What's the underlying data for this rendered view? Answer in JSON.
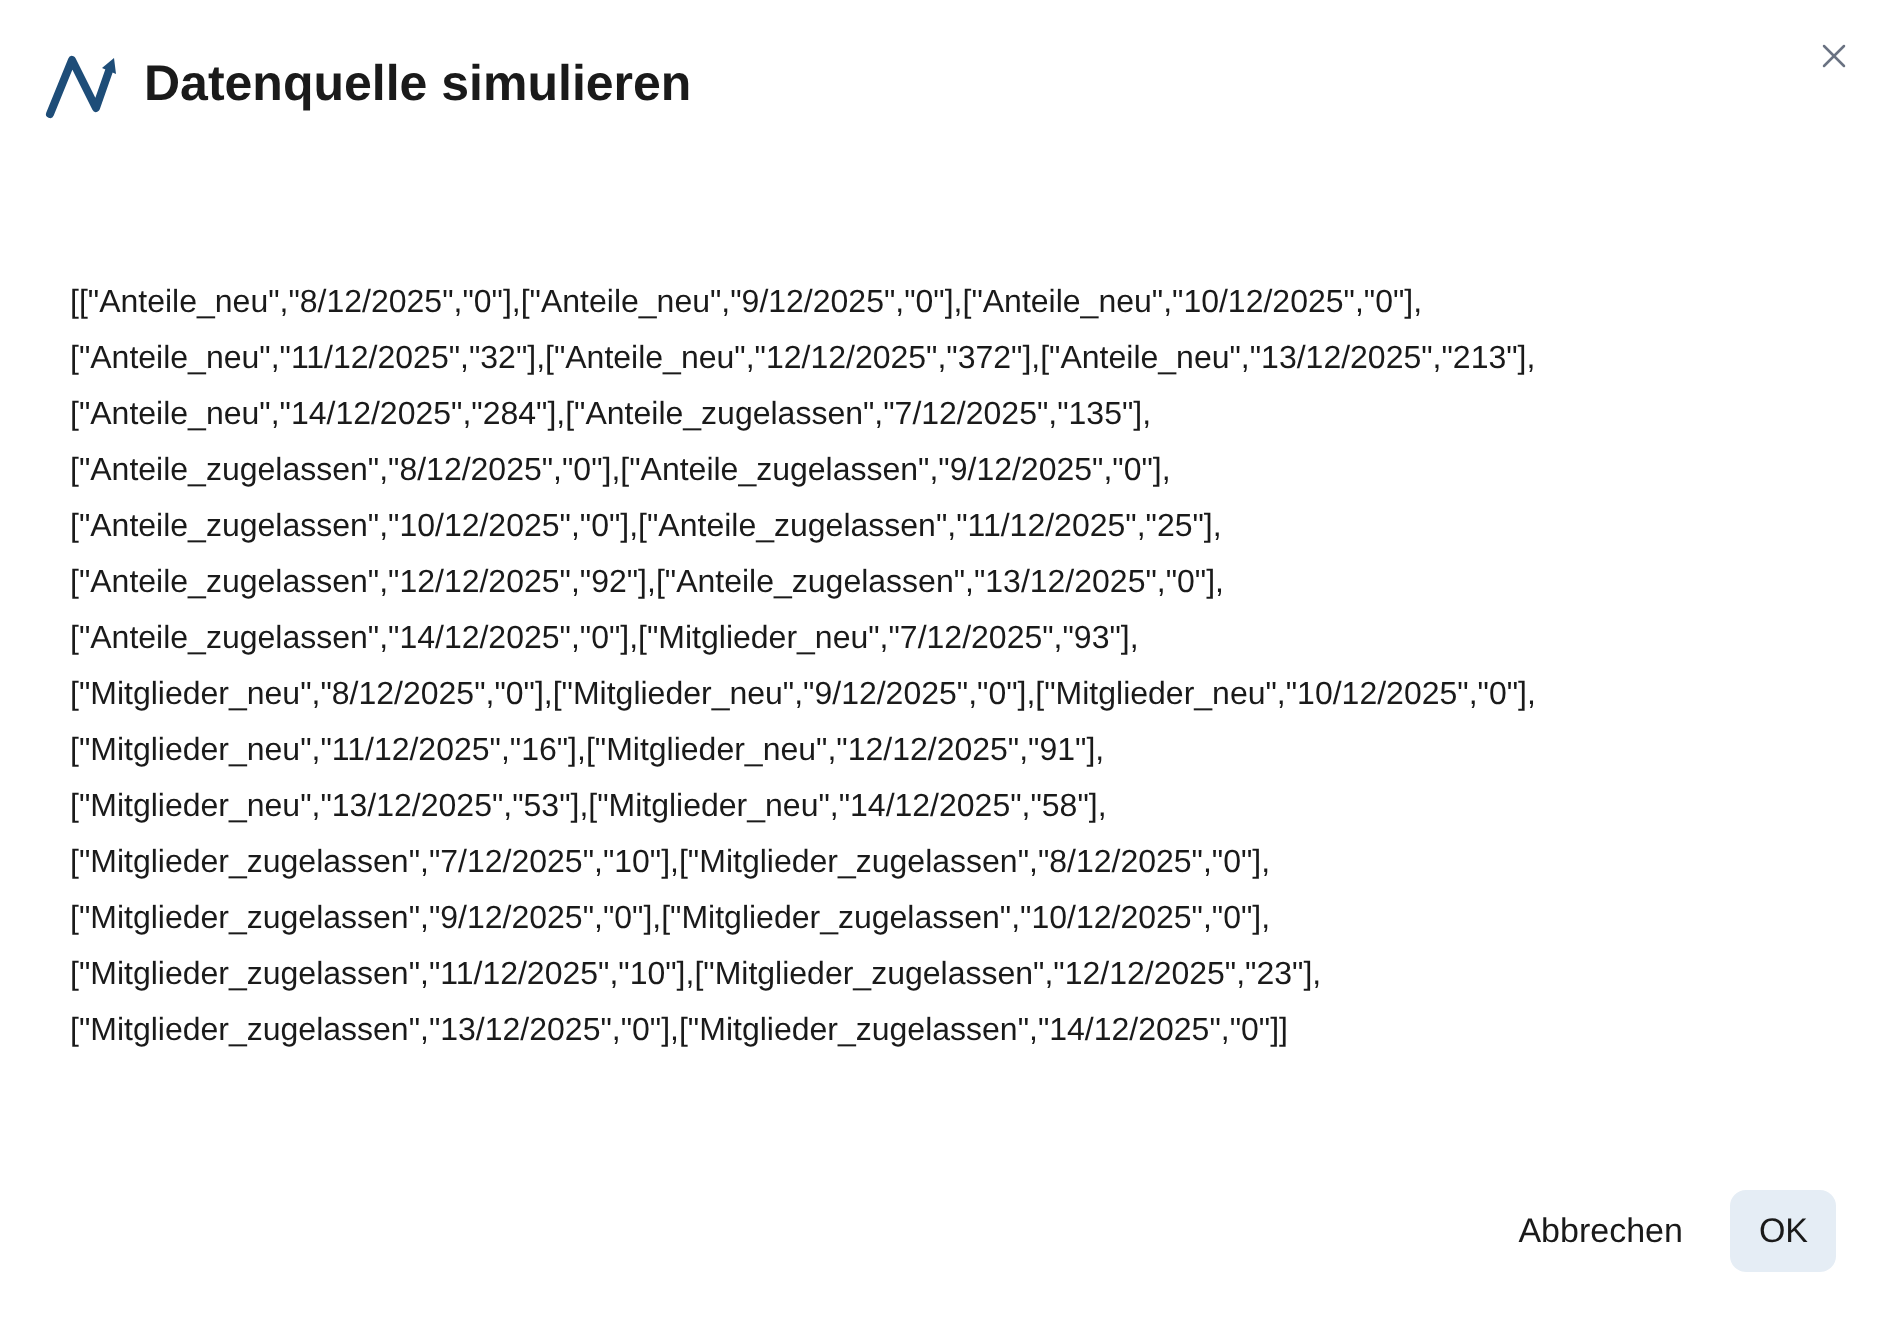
{
  "dialog": {
    "title": "Datenquelle simulieren",
    "body_lines": [
      "[[\"Anteile_neu\",\"8/12/2025\",\"0\"],[\"Anteile_neu\",\"9/12/2025\",\"0\"],[\"Anteile_neu\",\"10/12/2025\",\"0\"],",
      "[\"Anteile_neu\",\"11/12/2025\",\"32\"],[\"Anteile_neu\",\"12/12/2025\",\"372\"],[\"Anteile_neu\",\"13/12/2025\",\"213\"],",
      "[\"Anteile_neu\",\"14/12/2025\",\"284\"],[\"Anteile_zugelassen\",\"7/12/2025\",\"135\"],",
      "[\"Anteile_zugelassen\",\"8/12/2025\",\"0\"],[\"Anteile_zugelassen\",\"9/12/2025\",\"0\"],",
      "[\"Anteile_zugelassen\",\"10/12/2025\",\"0\"],[\"Anteile_zugelassen\",\"11/12/2025\",\"25\"],",
      "[\"Anteile_zugelassen\",\"12/12/2025\",\"92\"],[\"Anteile_zugelassen\",\"13/12/2025\",\"0\"],",
      "[\"Anteile_zugelassen\",\"14/12/2025\",\"0\"],[\"Mitglieder_neu\",\"7/12/2025\",\"93\"],",
      "[\"Mitglieder_neu\",\"8/12/2025\",\"0\"],[\"Mitglieder_neu\",\"9/12/2025\",\"0\"],[\"Mitglieder_neu\",\"10/12/2025\",\"0\"],",
      "[\"Mitglieder_neu\",\"11/12/2025\",\"16\"],[\"Mitglieder_neu\",\"12/12/2025\",\"91\"],",
      "[\"Mitglieder_neu\",\"13/12/2025\",\"53\"],[\"Mitglieder_neu\",\"14/12/2025\",\"58\"],",
      "[\"Mitglieder_zugelassen\",\"7/12/2025\",\"10\"],[\"Mitglieder_zugelassen\",\"8/12/2025\",\"0\"],",
      "[\"Mitglieder_zugelassen\",\"9/12/2025\",\"0\"],[\"Mitglieder_zugelassen\",\"10/12/2025\",\"0\"],",
      "[\"Mitglieder_zugelassen\",\"11/12/2025\",\"10\"],[\"Mitglieder_zugelassen\",\"12/12/2025\",\"23\"],",
      "[\"Mitglieder_zugelassen\",\"13/12/2025\",\"0\"],[\"Mitglieder_zugelassen\",\"14/12/2025\",\"0\"]]"
    ],
    "buttons": [
      {
        "label": "Abbrechen",
        "kind": "text"
      },
      {
        "label": "OK",
        "kind": "primary"
      }
    ]
  }
}
